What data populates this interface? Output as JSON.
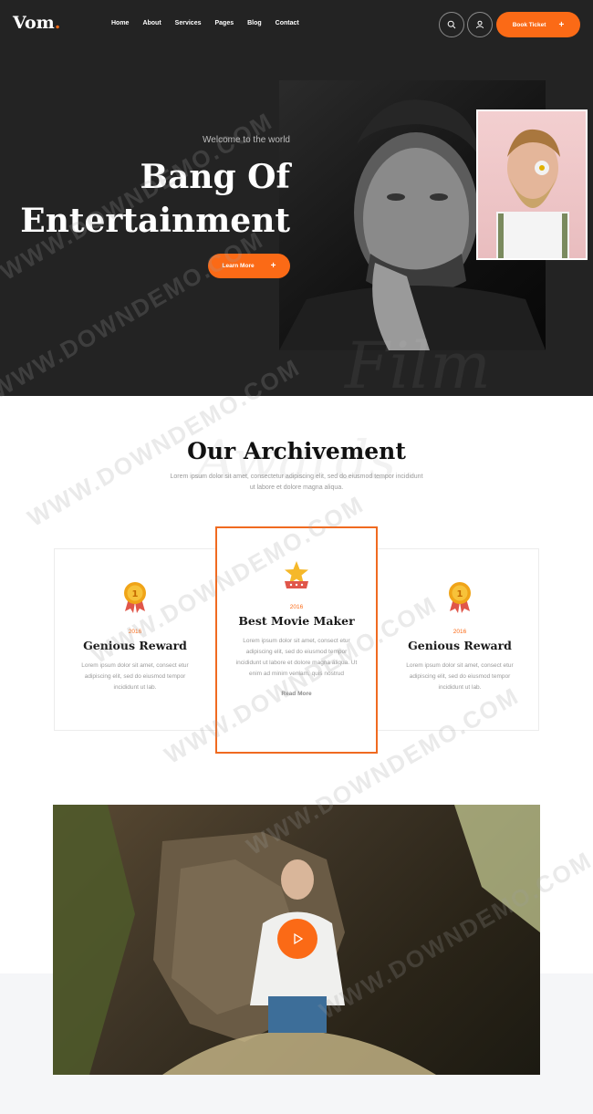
{
  "header": {
    "logo_text": "Vom",
    "logo_dot": ".",
    "nav": [
      "Home",
      "About",
      "Services",
      "Pages",
      "Blog",
      "Contact"
    ],
    "book_ticket_label": "Book Ticket",
    "plus_glyph": "+"
  },
  "hero": {
    "welcome": "Welcome to the world",
    "title_line1": "Bang Of",
    "title_line2": "Entertainment",
    "learn_more_label": "Learn More",
    "script_word": "Film"
  },
  "achievement": {
    "title": "Our Archivement",
    "script_word": "Awards",
    "description": "Lorem ipsum dolor sit amet, consectetur adipiscing elit, sed do eiusmod tempor incididunt ut labore et dolore magna aliqua.",
    "cards": [
      {
        "year": "2016",
        "title": "Genious Reward",
        "body": "Lorem ipsum dolor sit amet, consect etur adipiscing elit, sed do eiusmod tempor incididunt ut lab."
      },
      {
        "year": "2016",
        "title": "Best Movie Maker",
        "body": "Lorem ipsum dolor sit amet, consect etur adipiscing elit, sed do eiusmod tempor incididunt ut labore et dolore magna aliqua. Ut enim ad minim veniam, quis nostrud",
        "read_more": "Read More"
      },
      {
        "year": "2016",
        "title": "Genious Reward",
        "body": "Lorem ipsum dolor sit amet, consect etur adipiscing elit, sed do eiusmod tempor incididunt ut lab."
      }
    ]
  },
  "watermark": "WWW.DOWNDEMO.COM",
  "colors": {
    "accent": "#fb6a16",
    "dark_bg": "#232323"
  }
}
